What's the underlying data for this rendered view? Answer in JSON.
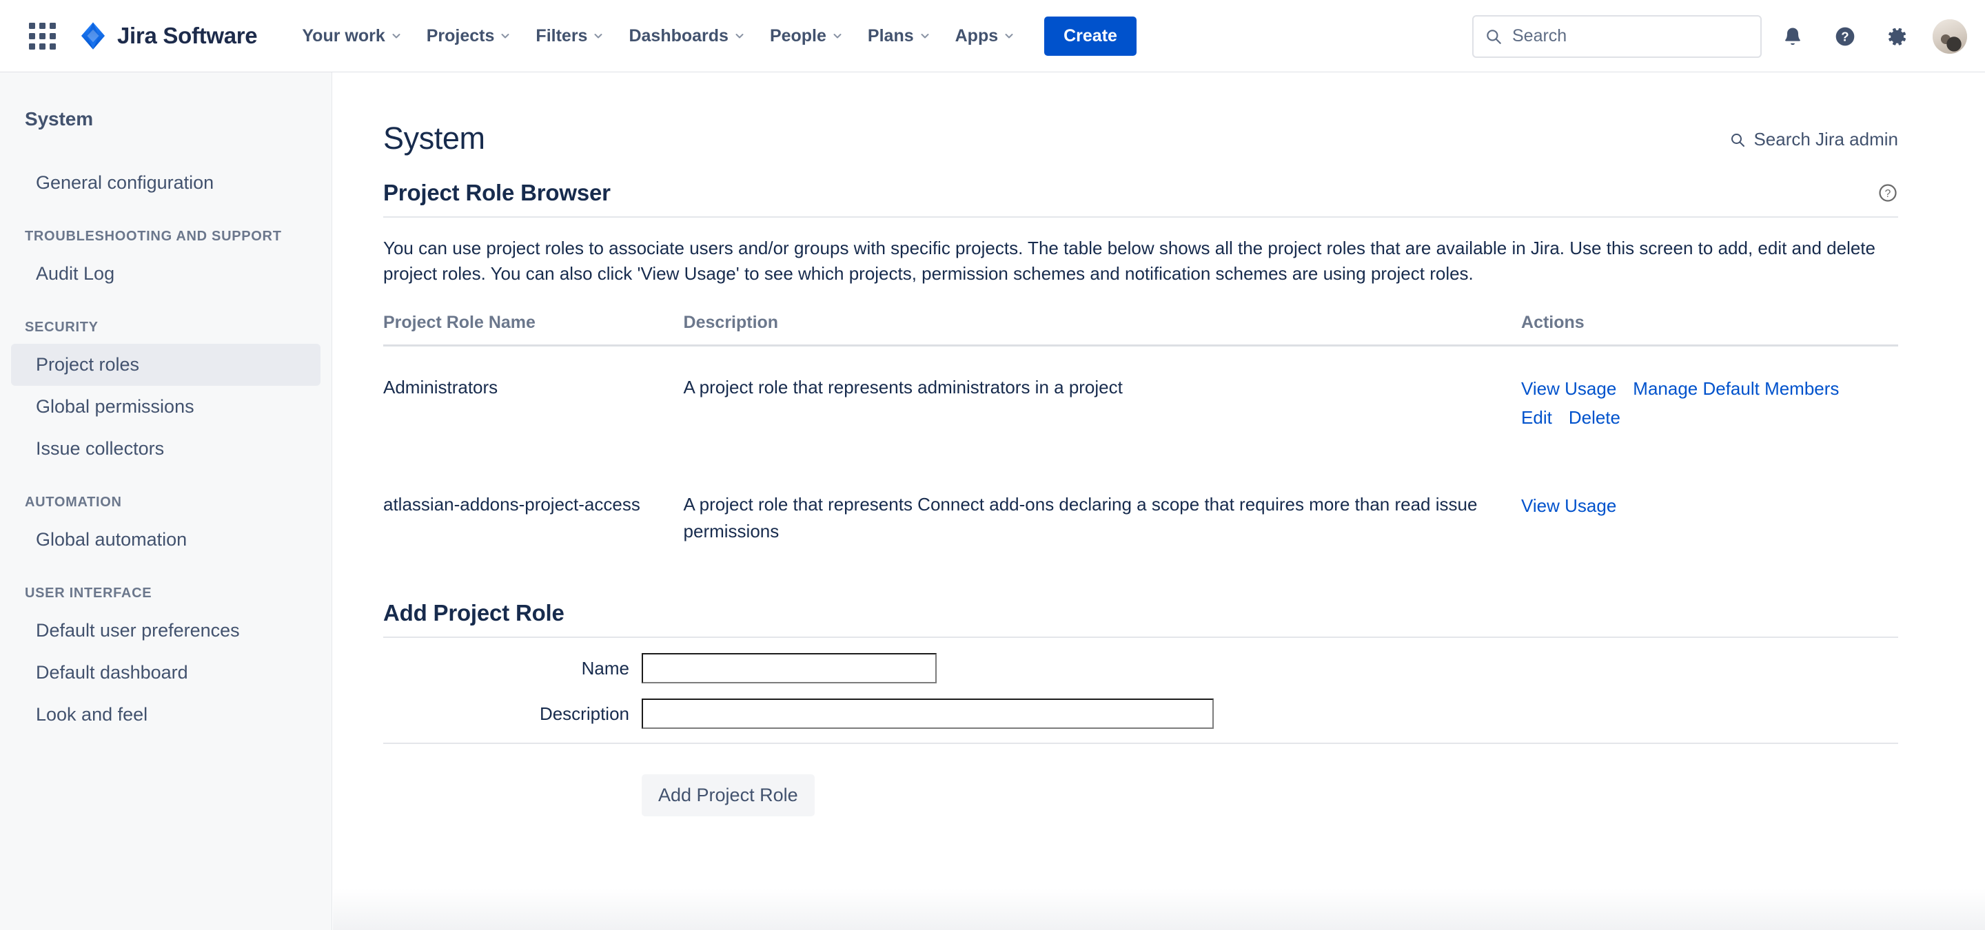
{
  "topnav": {
    "app_switcher_icon": "grid-apps-icon",
    "brand": {
      "logo_icon": "jira-diamond-logo",
      "name": "Jira Software"
    },
    "items": [
      {
        "label": "Your work",
        "icon": "chevron-down-icon"
      },
      {
        "label": "Projects",
        "icon": "chevron-down-icon"
      },
      {
        "label": "Filters",
        "icon": "chevron-down-icon"
      },
      {
        "label": "Dashboards",
        "icon": "chevron-down-icon"
      },
      {
        "label": "People",
        "icon": "chevron-down-icon"
      },
      {
        "label": "Plans",
        "icon": "chevron-down-icon"
      },
      {
        "label": "Apps",
        "icon": "chevron-down-icon"
      }
    ],
    "create_label": "Create",
    "search": {
      "placeholder": "Search",
      "value": "",
      "icon": "search-icon"
    },
    "notifications_icon": "bell-icon",
    "help_icon": "help-circle-icon",
    "settings_icon": "gear-icon",
    "avatar_name": "user-avatar"
  },
  "sidebar": {
    "title": "System",
    "groups": [
      {
        "label": "",
        "items": [
          {
            "label": "General configuration",
            "active": false
          }
        ]
      },
      {
        "label": "TROUBLESHOOTING AND SUPPORT",
        "items": [
          {
            "label": "Audit Log",
            "active": false
          }
        ]
      },
      {
        "label": "SECURITY",
        "items": [
          {
            "label": "Project roles",
            "active": true
          },
          {
            "label": "Global permissions",
            "active": false
          },
          {
            "label": "Issue collectors",
            "active": false
          }
        ]
      },
      {
        "label": "AUTOMATION",
        "items": [
          {
            "label": "Global automation",
            "active": false
          }
        ]
      },
      {
        "label": "USER INTERFACE",
        "items": [
          {
            "label": "Default user preferences",
            "active": false
          },
          {
            "label": "Default dashboard",
            "active": false
          },
          {
            "label": "Look and feel",
            "active": false
          }
        ]
      }
    ]
  },
  "main": {
    "page_title": "System",
    "admin_search": {
      "label": "Search Jira admin",
      "icon": "search-icon"
    },
    "section": {
      "title": "Project Role Browser",
      "help_icon": "help-circle-icon",
      "intro": "You can use project roles to associate users and/or groups with specific projects. The table below shows all the project roles that are available in Jira. Use this screen to add, edit and delete project roles. You can also click 'View Usage' to see which projects, permission schemes and notification schemes are using project roles."
    },
    "table": {
      "headers": [
        "Project Role Name",
        "Description",
        "Actions"
      ],
      "rows": [
        {
          "name": "Administrators",
          "description": "A project role that represents administrators in a project",
          "actions": [
            "View Usage",
            "Manage Default Members",
            "Edit",
            "Delete"
          ]
        },
        {
          "name": "atlassian-addons-project-access",
          "description": "A project role that represents Connect add-ons declaring a scope that requires more than read issue permissions",
          "actions": [
            "View Usage"
          ]
        }
      ]
    },
    "add_form": {
      "title": "Add Project Role",
      "name_label": "Name",
      "name_value": "",
      "description_label": "Description",
      "description_value": "",
      "submit_label": "Add Project Role"
    }
  },
  "colors": {
    "brand_blue": "#0052cc",
    "link_blue": "#0052cc",
    "text_dark": "#172b4d",
    "text_muted": "#6b778c",
    "sidebar_bg": "#f7f8f9",
    "active_item_bg": "#e9ebf0"
  }
}
